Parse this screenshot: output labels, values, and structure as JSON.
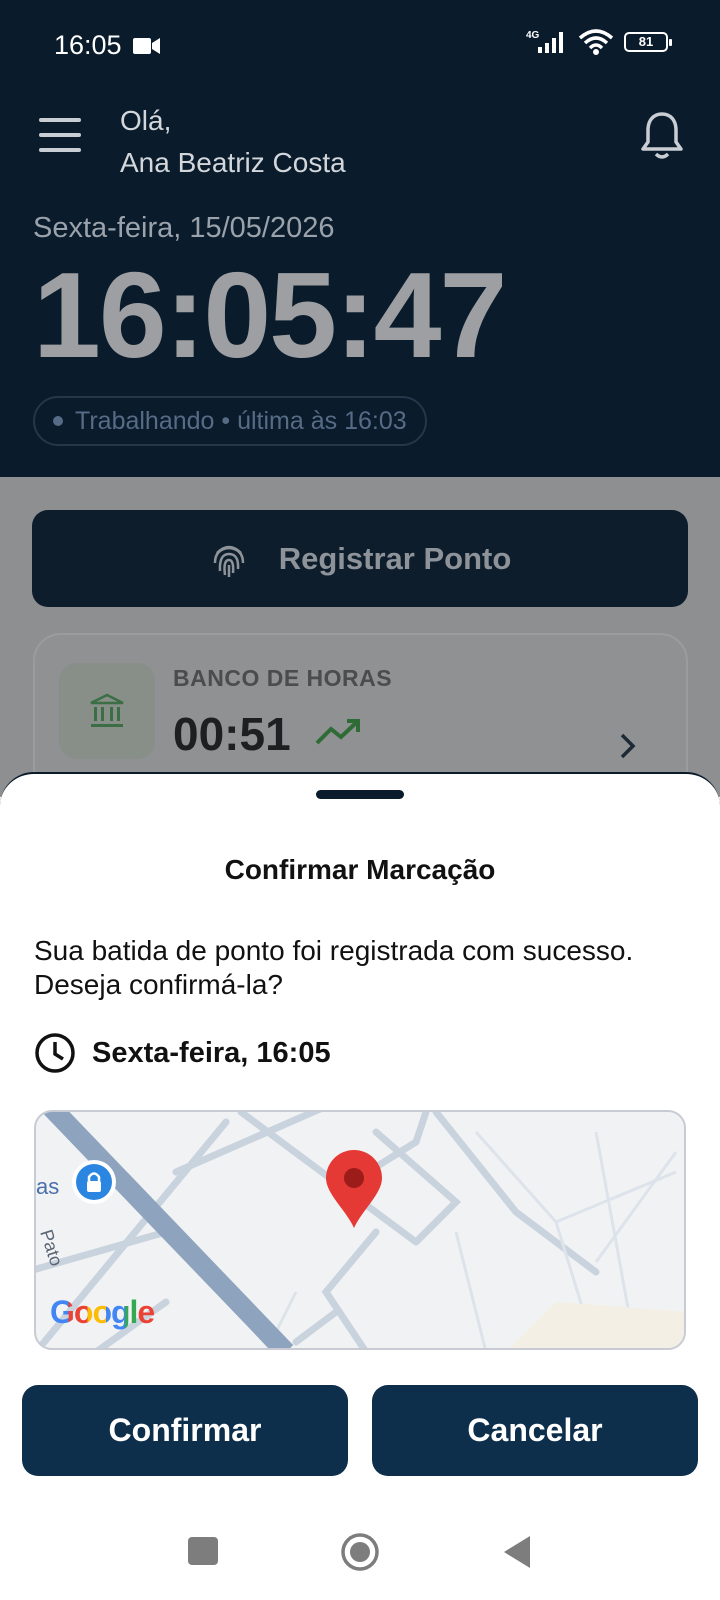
{
  "status_bar": {
    "time": "16:05",
    "network": "4G",
    "battery": "81"
  },
  "header": {
    "greeting": "Olá,",
    "user_name": "Ana Beatriz Costa",
    "date": "Sexta-feira, 15/05/2026",
    "clock": "16:05:47",
    "status": "Trabalhando • última às 16:03"
  },
  "register_button": {
    "label": "Registrar Ponto"
  },
  "bank_card": {
    "label": "BANCO DE HORAS",
    "value": "00:51"
  },
  "sheet": {
    "title": "Confirmar Marcação",
    "message": "Sua batida de ponto foi registrada com sucesso. Deseja confirmá-la?",
    "time": "Sexta-feira, 16:05",
    "map": {
      "partial_label": "as",
      "street_label": "Pato",
      "provider_logo": "Google"
    },
    "confirm_label": "Confirmar",
    "cancel_label": "Cancelar"
  },
  "colors": {
    "header_bg": "#0a1b2b",
    "button_bg": "#0d2f4b",
    "pin": "#e53935",
    "trend": "#2e7d32"
  },
  "icons": [
    "menu-icon",
    "bell-icon",
    "fingerprint-icon",
    "bank-icon",
    "trend-up-icon",
    "chevron-right-icon",
    "clock-icon",
    "map-pin-icon",
    "lock-pin-icon",
    "camera-icon",
    "signal-icon",
    "wifi-icon"
  ]
}
